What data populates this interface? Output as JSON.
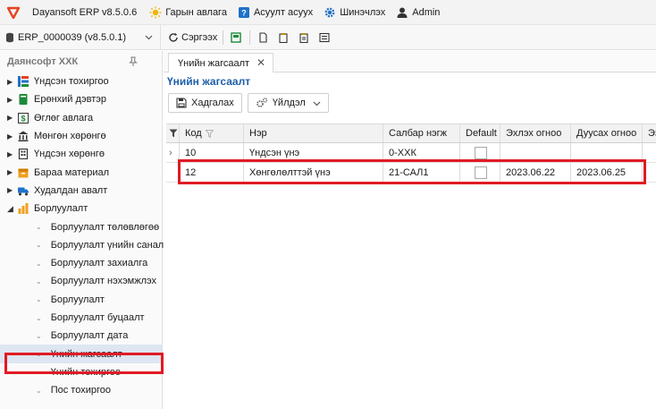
{
  "app": {
    "title": "Dayansoft ERP v8.5.0.6",
    "brand_color": "#e8411e"
  },
  "menu": [
    {
      "label": "Гарын авлага",
      "icon": "sun-icon"
    },
    {
      "label": "Асуулт асуух",
      "icon": "help-icon"
    },
    {
      "label": "Шинэчлэх",
      "icon": "gear-icon"
    },
    {
      "label": "Admin",
      "icon": "user-icon"
    }
  ],
  "toolbar": {
    "database": "ERP_0000039 (v8.5.0.1)",
    "refresh_label": "Сэргээх"
  },
  "sidebar": {
    "company": "Даянсофт ХХК",
    "items": [
      {
        "label": "Үндсэн тохиргоо"
      },
      {
        "label": "Ерөнхий дэвтэр"
      },
      {
        "label": "Өглөг авлага"
      },
      {
        "label": "Мөнгөн хөрөнгө"
      },
      {
        "label": "Үндсэн хөрөнгө"
      },
      {
        "label": "Бараа материал"
      },
      {
        "label": "Худалдан авалт"
      },
      {
        "label": "Борлуулалт"
      }
    ],
    "children": [
      {
        "label": "Борлуулалт төлөвлөгөө"
      },
      {
        "label": "Борлуулалт үнийн санал"
      },
      {
        "label": "Борлуулалт захиалга"
      },
      {
        "label": "Борлуулалт нэхэмжлэх"
      },
      {
        "label": "Борлуулалт"
      },
      {
        "label": "Борлуулалт буцаалт"
      },
      {
        "label": "Борлуулалт дата"
      },
      {
        "label": "Үнийн жагсаалт"
      },
      {
        "label": "Үнийн тохиргоо"
      },
      {
        "label": "Пос тохиргоо"
      }
    ]
  },
  "tab": {
    "label": "Үнийн жагсаалт"
  },
  "page": {
    "title": "Үнийн жагсаалт",
    "save_label": "Хадгалах",
    "action_label": "Үйлдэл"
  },
  "grid": {
    "columns": {
      "code": "Код",
      "name": "Нэр",
      "branch": "Салбар нэгж",
      "default": "Default",
      "start": "Эхлэх огноо",
      "end": "Дуусах огноо",
      "more": "Эз"
    },
    "rows": [
      {
        "code": "10",
        "name": "Үндсэн үнэ",
        "branch": "0-ХХК",
        "start": "",
        "end": ""
      },
      {
        "code": "12",
        "name": "Хөнгөлөлттэй үнэ",
        "branch": "21-САЛ1",
        "start": "2023.06.22",
        "end": "2023.06.25"
      }
    ]
  },
  "highlight_color": "#e01b24"
}
